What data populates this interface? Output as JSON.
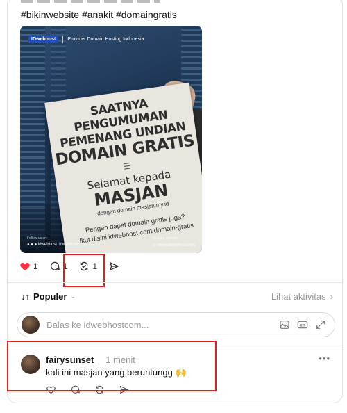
{
  "post": {
    "hashtags": "#bikinwebsite #anakit #domaingratis",
    "image": {
      "brand_logo": "IDwebhost",
      "brand_tagline": "Provider Domain Hosting Indonesia",
      "headline_line1": "SAATNYA PENGUMUMAN",
      "headline_line2": "PEMENANG UNDIAN",
      "headline_line3": "DOMAIN GRATIS",
      "congrats": "Selamat kepada",
      "winner": "MASJAN",
      "domain_note": "dengan domain masjan.my.id",
      "question": "Pengen dapat domain gratis juga?",
      "link": "Ikut disini idwebhost.com/domain-gratis",
      "follow_label": "Follow us on:",
      "social_handle": "idwebhost",
      "social_site": "idwebhostcom",
      "visit_label": "Visit our website:",
      "website": "www.idwebhost.com"
    },
    "actions": {
      "like_count": "1",
      "comment_count": "1",
      "repost_count": "1"
    }
  },
  "sort": {
    "label": "Populer",
    "activity_link": "Lihat aktivitas"
  },
  "reply": {
    "placeholder": "Balas ke idwebhostcom..."
  },
  "comment": {
    "username": "fairysunset_",
    "time": "1 menit",
    "text": "kali ini masjan yang beruntungg 🙌"
  },
  "colors": {
    "like": "#ff3040",
    "highlight": "#e21d1d"
  },
  "icons": [
    "heart-icon",
    "comment-icon",
    "repost-icon",
    "share-icon",
    "chevron-down-icon",
    "chevron-right-icon",
    "image-icon",
    "gif-icon",
    "expand-icon",
    "more-icon"
  ]
}
